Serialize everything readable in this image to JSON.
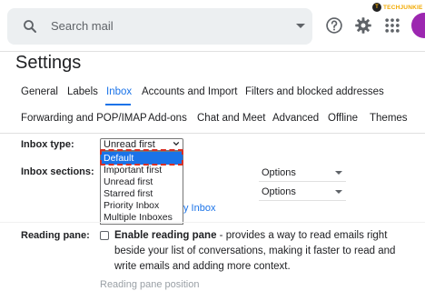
{
  "search": {
    "placeholder": "Search mail"
  },
  "logo": {
    "mark": "T",
    "text": "TECHJUNKIE"
  },
  "page_title": "Settings",
  "tabs_row1": [
    "General",
    "Labels",
    "Inbox",
    "Accounts and Import",
    "Filters and blocked addresses"
  ],
  "tabs_row2": [
    "Forwarding and POP/IMAP",
    "Add-ons",
    "Chat and Meet",
    "Advanced",
    "Offline",
    "Themes"
  ],
  "active_tab": "Inbox",
  "inbox_type": {
    "label": "Inbox type:",
    "selected": "Unread first",
    "options": [
      "Default",
      "Important first",
      "Unread first",
      "Starred first",
      "Priority Inbox",
      "Multiple Inboxes"
    ],
    "highlighted": "Default"
  },
  "inbox_sections": {
    "label": "Inbox sections:",
    "options_label_1": "Options",
    "options_label_2": "Options",
    "partial_link": "y Inbox"
  },
  "reading_pane": {
    "label": "Reading pane:",
    "checkbox_label": "Enable reading pane",
    "description": " - provides a way to read emails right beside your list of conversations, making it faster to read and write emails and adding more context.",
    "position_label": "Reading pane position"
  },
  "colors": {
    "accent": "#1a73e8",
    "highlight_border": "#d93025",
    "avatar": "#9c27b0",
    "logo": "#f2a900"
  }
}
